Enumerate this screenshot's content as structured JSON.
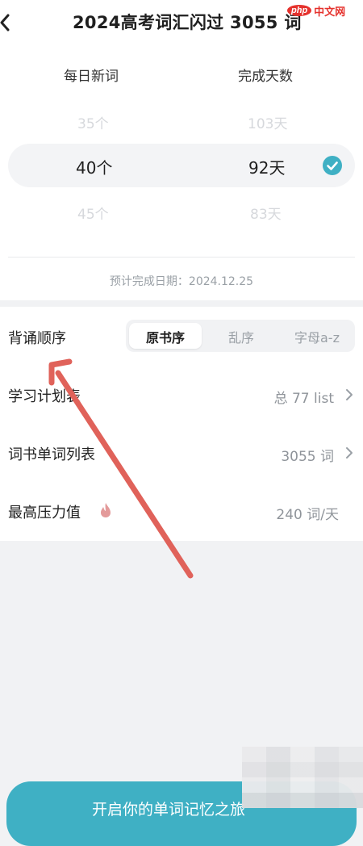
{
  "header": {
    "title": "2024高考词汇闪过 3055 词",
    "watermark_badge": "php",
    "watermark_text": "中文网"
  },
  "picker": {
    "col_daily": "每日新词",
    "col_days": "完成天数",
    "rows": [
      {
        "words": "35个",
        "days": "103天"
      },
      {
        "words": "40个",
        "days": "92天"
      },
      {
        "words": "45个",
        "days": "83天"
      }
    ],
    "selected_index": 1,
    "estimate": "预计完成日期：2024.12.25"
  },
  "settings": {
    "order_label": "背诵顺序",
    "order_options": [
      "原书序",
      "乱序",
      "字母a-z"
    ],
    "order_selected": 0,
    "plan_label": "学习计划表",
    "plan_value": "总 77 list",
    "list_label": "词书单词列表",
    "list_value": "3055 词",
    "pressure_label": "最高压力值",
    "pressure_value": "240 词/天"
  },
  "cta": {
    "label": "开启你的单词记忆之旅"
  },
  "colors": {
    "accent": "#3fb0c4",
    "annotation": "#e0625a",
    "flame": "#e39a9a"
  }
}
